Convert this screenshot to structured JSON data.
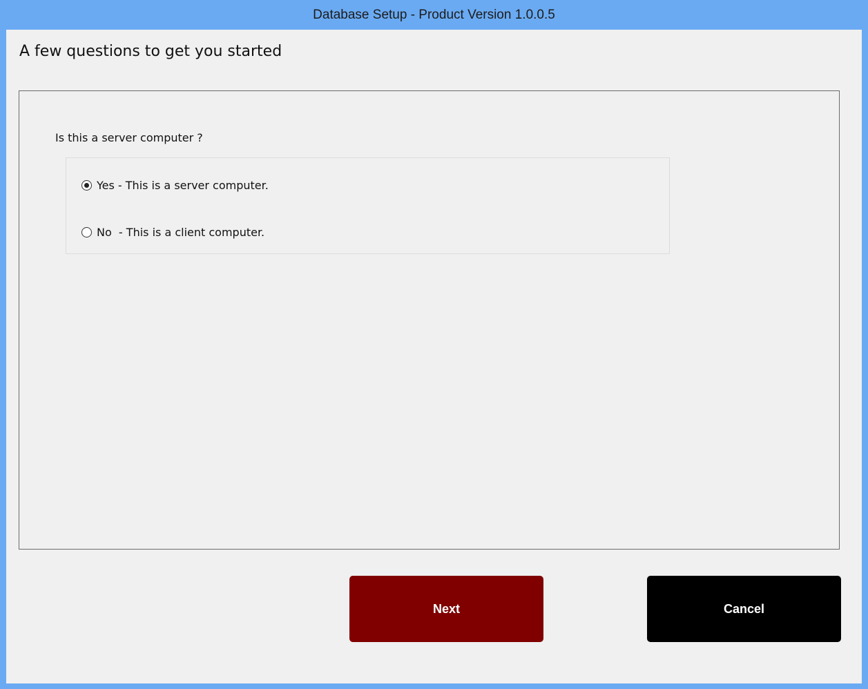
{
  "window": {
    "title": "Database Setup - Product Version 1.0.0.5"
  },
  "page": {
    "heading": "A few questions to get you started"
  },
  "question": {
    "label": "Is this a server computer ?",
    "options": [
      {
        "label": "Yes - This is a server computer.",
        "selected": true
      },
      {
        "label": "No  - This is a client computer.",
        "selected": false
      }
    ]
  },
  "buttons": {
    "next": {
      "label": "Next",
      "color": "#800000"
    },
    "cancel": {
      "label": "Cancel",
      "color": "#000000"
    }
  },
  "colors": {
    "titlebar": "#6aaaf2",
    "background": "#f0f0f0"
  }
}
